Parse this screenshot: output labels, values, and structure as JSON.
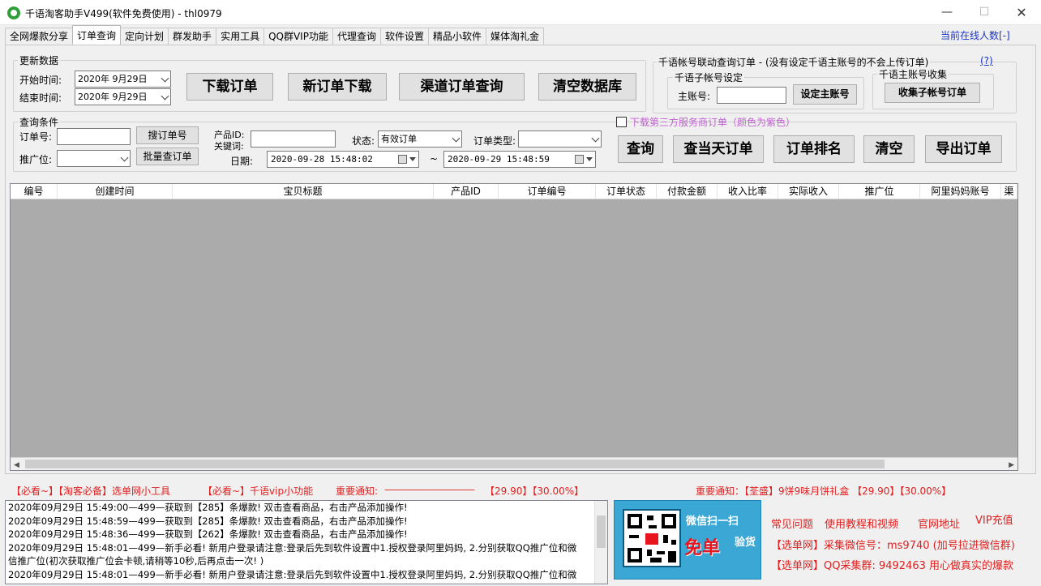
{
  "window": {
    "title": "千语淘客助手V499(软件免费使用) - thl0979",
    "controls": {
      "min": "—",
      "max": "☐",
      "close": "✕"
    }
  },
  "tabs": [
    "全网爆款分享",
    "订单查询",
    "定向计划",
    "群发助手",
    "实用工具",
    "QQ群VIP功能",
    "代理查询",
    "软件设置",
    "精品小软件",
    "媒体淘礼金"
  ],
  "active_tab": "订单查询",
  "online_count": "当前在线人数[-]",
  "update": {
    "group_label": "更新数据",
    "start_label": "开始时间:",
    "start_value": "2020年 9月29日",
    "end_label": "结束时间:",
    "end_value": "2020年 9月29日",
    "btn_download": "下载订单",
    "btn_new_download": "新订单下载",
    "btn_channel": "渠道订单查询",
    "btn_clear_db": "清空数据库"
  },
  "linkage": {
    "group_label": "千语帐号联动查询订单 - (没有设定千语主账号的不会上传订单)",
    "help": "(?)",
    "sub_group_label": "千语子帐号设定",
    "main_account_label": "主账号:",
    "main_account_value": "",
    "set_main_btn": "设定主账号",
    "collect_group_label": "千语主账号收集",
    "collect_btn": "收集子帐号订单"
  },
  "query": {
    "group_label": "查询条件",
    "order_no_label": "订单号:",
    "order_no_value": "",
    "search_btn": "搜订单号",
    "adzone_label": "推广位:",
    "adzone_value": "",
    "batch_btn": "批量查订单",
    "product_label_1": "产品ID:",
    "product_label_2": "关键词:",
    "product_value": "",
    "status_label": "状态:",
    "status_value": "有效订单",
    "order_type_label": "订单类型:",
    "order_type_value": "",
    "date_label": "日期:",
    "date_from": "2020-09-28 15:48:02",
    "date_sep": "~",
    "date_to": "2020-09-29 15:48:59",
    "third_party_label": "下载第三方服务商订单（颜色为紫色）",
    "third_party_checked": false,
    "btn_query": "查询",
    "btn_today": "查当天订单",
    "btn_rank": "订单排名",
    "btn_clear": "清空",
    "btn_export": "导出订单"
  },
  "grid": {
    "columns": [
      "编号",
      "创建时间",
      "宝贝标题",
      "产品ID",
      "订单编号",
      "订单状态",
      "付款金额",
      "收入比率",
      "实际收入",
      "推广位",
      "阿里妈妈账号",
      "渠"
    ],
    "scroll_left": "◀",
    "scroll_right": "▶"
  },
  "links": {
    "left": [
      "【必看~】【淘客必备】选单网小工具",
      "【必看~】千语vip小功能"
    ],
    "notice_label": "重要通知:",
    "notice_line": "———————————",
    "notice_price_1": "【29.90】【30.00%】",
    "notice_right": "重要通知：【荃盛】9饼9味月饼礼盒 【29.90】【30.00%】"
  },
  "log": [
    "2020年09月29日 15:49:00—499—获取到【285】条爆款! 双击查看商品，右击产品添加操作!",
    "2020年09月29日 15:48:59—499—获取到【285】条爆款! 双击查看商品，右击产品添加操作!",
    "2020年09月29日 15:48:36—499—获取到【262】条爆款! 双击查看商品，右击产品添加操作!",
    "2020年09月29日 15:48:01—499—新手必看! 新用户登录请注意:登录后先到软件设置中1.授权登录阿里妈妈, 2.分别获取QQ推广位和微",
    "信推广位(初次获取推广位会卡顿,请稍等10秒,后再点击一次! )",
    "2020年09月29日 15:48:01—499—新手必看! 新用户登录请注意:登录后先到软件设置中1.授权登录阿里妈妈, 2.分别获取QQ推广位和微"
  ],
  "ad": {
    "top": "微信扫一扫",
    "big": "免单",
    "side": "验货"
  },
  "right_links": {
    "faq": "常见问题",
    "tutorial": "使用教程和视频",
    "official": "官网地址",
    "vip": "VIP充值",
    "wechat": "【选单网】采集微信号：ms9740 (加号拉进微信群)",
    "qq": "【选单网】QQ采集群: 9492463 用心做真实的爆款"
  },
  "colors": {
    "accent_link": "#1a35c8",
    "red": "#e02020",
    "purple_checkbox": "#c060d0",
    "grid_bg": "#ababab"
  }
}
